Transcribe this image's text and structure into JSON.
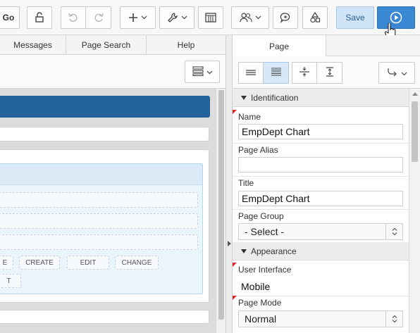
{
  "toolbar": {
    "go_label": "Go",
    "save_label": "Save",
    "icons": [
      "lock-icon",
      "undo-icon",
      "redo-icon",
      "plus-icon",
      "wrench-icon",
      "grid-icon",
      "team-icon",
      "comment-icon",
      "shapes-icon",
      "play-icon"
    ]
  },
  "left_tabs": [
    {
      "label": "Messages"
    },
    {
      "label": "Page Search"
    },
    {
      "label": "Help"
    }
  ],
  "canvas": {
    "buttons": [
      "E",
      "CREATE",
      "EDIT",
      "CHANGE",
      "T"
    ]
  },
  "right_panel": {
    "tab": "Page",
    "sections": {
      "identification": "Identification",
      "appearance": "Appearance"
    },
    "fields": {
      "name": {
        "label": "Name",
        "value": "EmpDept Chart"
      },
      "page_alias": {
        "label": "Page Alias",
        "value": ""
      },
      "title": {
        "label": "Title",
        "value": "EmpDept Chart"
      },
      "page_group": {
        "label": "Page Group",
        "value": "- Select -"
      },
      "user_interface": {
        "label": "User Interface",
        "value": "Mobile"
      },
      "page_mode": {
        "label": "Page Mode",
        "value": "Normal"
      }
    }
  },
  "colors": {
    "accent": "#3a87d4",
    "header_bar": "#22639e",
    "required_flag": "#d9262b"
  }
}
